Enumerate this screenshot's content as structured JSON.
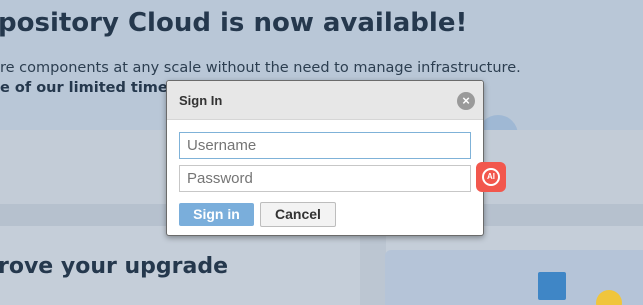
{
  "background": {
    "hero_title": "pository Cloud is now available!",
    "hero_text": "re components at any scale without the need to manage infrastructure.",
    "hero_text_bold": "e of our limited time pro",
    "section_title": "rove your upgrade"
  },
  "dialog": {
    "title": "Sign In",
    "close_icon": "close-icon",
    "username_placeholder": "Username",
    "password_placeholder": "Password",
    "signin_label": "Sign in",
    "cancel_label": "Cancel"
  },
  "ai_badge": {
    "label": "AI",
    "color": "#f2574d"
  }
}
